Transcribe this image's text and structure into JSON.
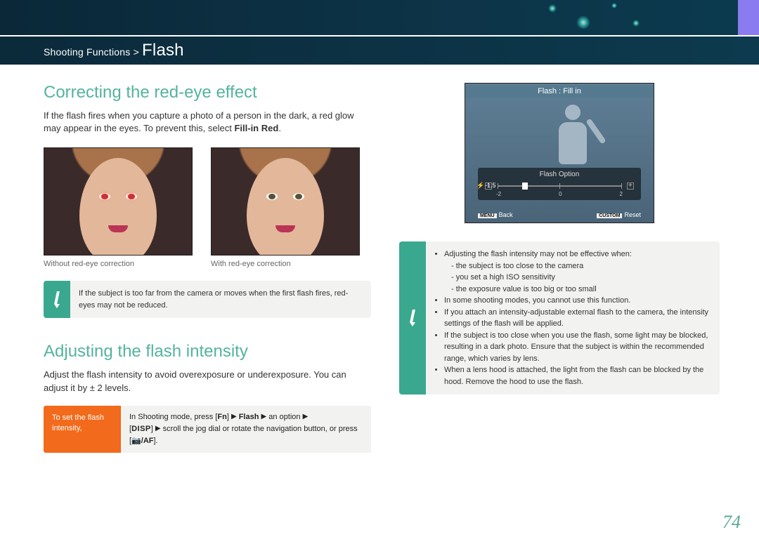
{
  "breadcrumb": {
    "section": "Shooting Functions",
    "sep": ">",
    "page": "Flash"
  },
  "heading1": "Correcting the red-eye effect",
  "intro1a": "If the flash fires when you capture a photo of a person in the dark, a red glow may appear in the eyes. To prevent this, select ",
  "intro1b": "Fill-in Red",
  "intro1c": ".",
  "caption_without": "Without red-eye correction",
  "caption_with": "With red-eye correction",
  "note1": "If the subject is too far from the camera or moves when the first flash fires, red-eyes may not be reduced.",
  "heading2": "Adjusting the flash intensity",
  "intro2": "Adjust the flash intensity to avoid overexposure or underexposure. You can adjust it by ± 2 levels.",
  "instr_label": "To set the flash intensity,",
  "instr": {
    "a": "In Shooting mode, press [",
    "fn": "Fn",
    "b": "] ",
    "c": " Flash ",
    "d": " an option ",
    "e": "[",
    "disp": "DISP",
    "f": "] ",
    "g": " scroll the jog dial or rotate the navigation button, or press [",
    "ok": " ⚯/AF",
    "h": "]."
  },
  "cam": {
    "title": "Flash : Fill in",
    "panel_title": "Flash Option",
    "value": "-1.5",
    "ticks": [
      "-2",
      "0",
      "2"
    ],
    "back_key": "MENU",
    "back": "Back",
    "reset_key": "CUSTOM",
    "reset": "Reset"
  },
  "note2": {
    "l1": "Adjusting the flash intensity may not be effective when:",
    "s1": "the subject is too close to the camera",
    "s2": "you set a high ISO sensitivity",
    "s3": "the exposure value is too big or too small",
    "l2": "In some shooting modes, you cannot use this function.",
    "l3": "If you attach an intensity-adjustable external flash to the camera, the intensity settings of the flash will be applied.",
    "l4": "If the subject is too close when you use the flash, some light may be blocked, resulting in a dark photo. Ensure that the subject is within the recommended range, which varies by lens.",
    "l5": "When a lens hood is attached, the light from the flash can be blocked by the hood. Remove the hood to use the flash."
  },
  "pagenum": "74"
}
